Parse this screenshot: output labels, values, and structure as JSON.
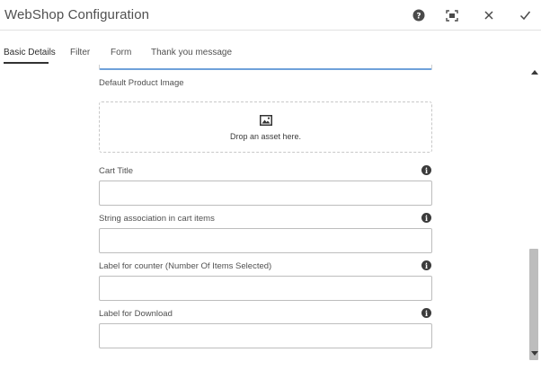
{
  "header": {
    "title": "WebShop Configuration",
    "buttons": {
      "help": "help-icon",
      "fullscreen": "fullscreen-icon",
      "close": "close-icon",
      "done": "checkmark-icon"
    }
  },
  "tabs": [
    {
      "label": "Basic Details",
      "active": true
    },
    {
      "label": "Filter",
      "active": false
    },
    {
      "label": "Form",
      "active": false
    },
    {
      "label": "Thank you message",
      "active": false
    }
  ],
  "form": {
    "default_product_image": {
      "label": "Default Product Image",
      "drop_text": "Drop an asset here.",
      "icon": "image-icon"
    },
    "fields": [
      {
        "label": "Cart Title",
        "value": ""
      },
      {
        "label": "String association in cart items",
        "value": ""
      },
      {
        "label": "Label for counter (Number Of Items Selected)",
        "value": ""
      },
      {
        "label": "Label for Download",
        "value": ""
      }
    ],
    "info_icon_glyph": "i"
  },
  "colors": {
    "focus_border": "#6fa1da",
    "text": "#505050",
    "active_tab_underline": "#323232"
  }
}
